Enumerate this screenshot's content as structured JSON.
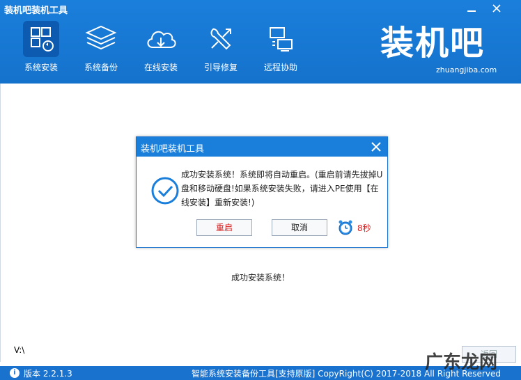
{
  "window": {
    "title": "装机吧装机工具",
    "minimize_icon": "minimize-icon",
    "close_icon": "close-icon"
  },
  "nav": {
    "items": [
      {
        "label": "系统安装",
        "icon": "windows-install-icon",
        "active": true
      },
      {
        "label": "系统备份",
        "icon": "layers-backup-icon",
        "active": false
      },
      {
        "label": "在线安装",
        "icon": "cloud-download-icon",
        "active": false
      },
      {
        "label": "引导修复",
        "icon": "wrench-icon",
        "active": false
      },
      {
        "label": "远程协助",
        "icon": "remote-monitor-icon",
        "active": false
      }
    ]
  },
  "brand": {
    "name": "装机吧",
    "url": "zhuangjiba.com"
  },
  "main": {
    "status_text": "成功安装系统！",
    "drive_label": "V:\\",
    "return_button": "返回"
  },
  "dialog": {
    "title": "装机吧装机工具",
    "message": "成功安装系统！系统即将自动重启。(重启前请先拔掉U盘和移动硬盘!如果系统安装失败，请进入PE使用【在线安装】重新安装!)",
    "restart_button": "重启",
    "cancel_button": "取消",
    "countdown": "8秒"
  },
  "footer": {
    "version": "版本 2.2.1.3",
    "copyright": "智能系统安装备份工具[支持原版]  CopyRight(C) 2017-2018 All Right Reserved"
  },
  "watermark": "广东龙网",
  "colors": {
    "header_blue": "#1a7fdb",
    "footer_blue": "#1a72cf",
    "active_nav": "#0c5bb1",
    "restart_red": "#d81e1e"
  }
}
